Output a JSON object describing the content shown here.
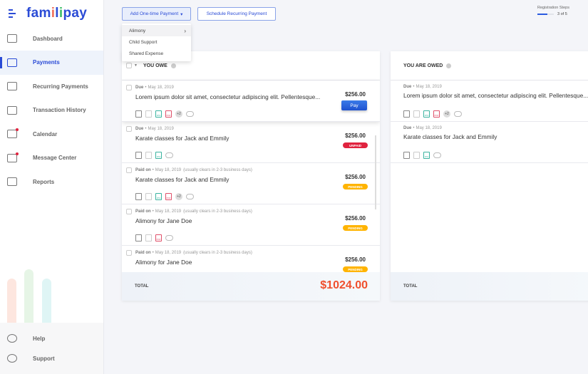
{
  "app": {
    "logo_a": "fam",
    "logo_i1": "i",
    "logo_l": "l",
    "logo_i2": "i",
    "logo_b": "pay"
  },
  "sidebar": {
    "items": [
      {
        "label": "Dashboard",
        "icon": "bar-chart-icon"
      },
      {
        "label": "Payments",
        "icon": "payment-card-icon",
        "active": true
      },
      {
        "label": "Recurring Payments",
        "icon": "clock-icon"
      },
      {
        "label": "Transaction History",
        "icon": "book-icon"
      },
      {
        "label": "Calendar",
        "icon": "calendar-icon",
        "dot": true
      },
      {
        "label": "Message Center",
        "icon": "message-icon",
        "dot": true
      },
      {
        "label": "Reports",
        "icon": "document-icon"
      }
    ],
    "bottom": [
      {
        "label": "Help",
        "icon": "help-icon"
      },
      {
        "label": "Support",
        "icon": "headset-icon"
      }
    ]
  },
  "toolbar": {
    "add_label": "Add One-time Payment",
    "schedule_label": "Schedule Recurring Payment"
  },
  "dropdown": [
    "Alimony",
    "Child Support",
    "Shared Expense"
  ],
  "registration": {
    "label": "Registration Steps",
    "count": "3 of 5",
    "progress": 0.6
  },
  "owe": {
    "title": "YOU OWE",
    "total_label": "TOTAL",
    "total": "$1024.00",
    "rows": [
      {
        "status": "Due",
        "date": "May 18, 2019",
        "note": "",
        "title": "Lorem ipsum dolor sit amet, consectetur adipiscing elit. Pellentesque...",
        "amount": "$256.00",
        "action": "Pay",
        "files": [
          "jpg",
          "pdf"
        ],
        "more": "+2"
      },
      {
        "status": "Due",
        "date": "May 18, 2019",
        "note": "",
        "title": "Karate classes for Jack and Emmily",
        "amount": "$256.00",
        "badge": "UNPAID",
        "files": [
          "jpg"
        ]
      },
      {
        "status": "Paid on",
        "date": "May 18, 2019",
        "note": "(usually clears in 2-3 business days)",
        "title": "Karate classes for Jack and Emmily",
        "amount": "$256.00",
        "badge": "PENDING",
        "files": [
          "jpg",
          "pdf"
        ],
        "more": "+2"
      },
      {
        "status": "Paid on",
        "date": "May 18, 2019",
        "note": "(usually clears in 2-3 business days)",
        "title": "Alimony for Jane Doe",
        "amount": "$256.00",
        "badge": "PENDING",
        "files": [
          "pdf"
        ]
      },
      {
        "status": "Paid on",
        "date": "May 18, 2019",
        "note": "(usually clears in 2-3 business days)",
        "title": "Alimony for Jane Doe",
        "amount": "$256.00",
        "badge": "PENDING",
        "files": []
      }
    ]
  },
  "owed": {
    "title": "YOU ARE OWED",
    "total_label": "TOTAL",
    "rows": [
      {
        "status": "Due",
        "date": "May 18, 2019",
        "note": "",
        "title": "Lorem ipsum dolor sit amet, consectetur adipiscing elit. Pellentesque...",
        "files": [
          "jpg",
          "pdf"
        ],
        "more": "+2"
      },
      {
        "status": "Due",
        "date": "May 18, 2019",
        "note": "",
        "title": "Karate classes for Jack and Emmily",
        "files": [
          "jpg"
        ]
      }
    ]
  },
  "colors": {
    "accent": "#2a4bd6",
    "unpaid": "#e0233f",
    "pending": "#ffb400",
    "total": "#f0502e"
  }
}
